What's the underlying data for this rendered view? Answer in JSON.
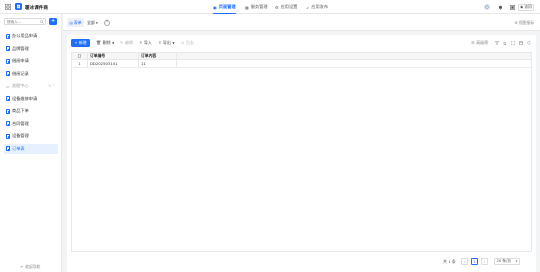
{
  "app": {
    "title": "暖冰课件商"
  },
  "topnav": [
    {
      "label": "页面管理",
      "icon": "page-icon",
      "active": true
    },
    {
      "label": "服务管理",
      "icon": "grid-icon",
      "active": false
    },
    {
      "label": "应用设置",
      "icon": "gear-icon",
      "active": false
    },
    {
      "label": "应用发布",
      "icon": "send-icon",
      "active": false
    }
  ],
  "header": {
    "user_label": "访问"
  },
  "sidebar": {
    "search_placeholder": "搜索入...",
    "items": [
      {
        "label": "办公用品申请",
        "active": false
      },
      {
        "label": "品牌管理",
        "active": false
      },
      {
        "label": "借阅申请",
        "active": false
      },
      {
        "label": "借阅记录",
        "active": false
      },
      {
        "label": "流程中心",
        "group": true
      },
      {
        "label": "设备维修申请",
        "active": false
      },
      {
        "label": "商品下单",
        "active": false
      },
      {
        "label": "合同管理",
        "active": false
      },
      {
        "label": "设备管理",
        "active": false
      },
      {
        "label": "订单表",
        "active": true
      }
    ],
    "footer_label": "收起导航"
  },
  "tabs": {
    "items": [
      {
        "label": "表单"
      },
      {
        "label": "全部"
      }
    ],
    "right_label": "视图指标"
  },
  "toolbar": {
    "new_label": "+ 新增",
    "delete_label": "删除",
    "edit_label": "编辑",
    "import_label": "导入",
    "export_label": "导出",
    "log_label": "日志",
    "adv_label": "高级筛"
  },
  "table": {
    "columns": [
      "",
      "订单编号",
      "订单内容"
    ],
    "rows": [
      [
        "1",
        "DD202503101",
        "11"
      ]
    ]
  },
  "pagination": {
    "total_label": "共 1 条",
    "current_page": "1",
    "page_size_label": "20 条/页"
  },
  "colors": {
    "accent": "#1e6fff",
    "active_bg": "#e6f0ff"
  }
}
